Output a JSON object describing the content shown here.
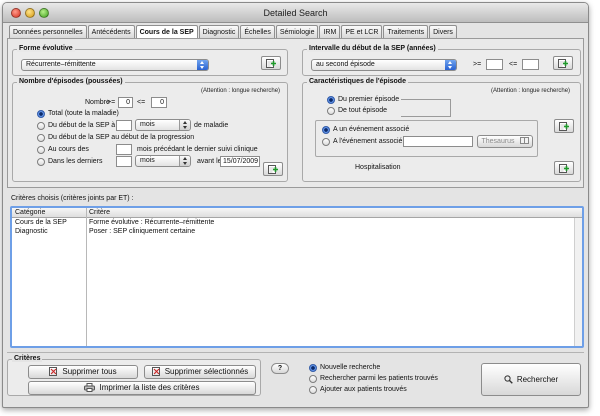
{
  "window": {
    "title": "Detailed Search"
  },
  "tabs": [
    "Données personnelles",
    "Antécédents",
    "Cours de la SEP",
    "Diagnostic",
    "Échelles",
    "Sémiologie",
    "IRM",
    "PE et LCR",
    "Traitements",
    "Divers"
  ],
  "active_tab": "Cours de la SEP",
  "forme_evolutive": {
    "title": "Forme évolutive",
    "value": "Récurrente–rémittente"
  },
  "intervalle": {
    "title": "Intervalle du début de la SEP (années)",
    "value": "au second épisode",
    "gte": ">=",
    "lte": "<=",
    "min": "",
    "max": ""
  },
  "episodes": {
    "title": "Nombre d'épisodes (poussées)",
    "warning": "(Attention : longue recherche)",
    "nombre_label": "Nombre",
    "gte": ">=",
    "lte": "<=",
    "min": "0",
    "max": "0",
    "options": [
      "Total (toute la maladie)",
      "Du début de la SEP à",
      "Du début de la SEP au début de la progression",
      "Au cours des",
      "Dans les derniers"
    ],
    "selected": "Total (toute la maladie)",
    "period_unit_1": "mois",
    "de_maladie": "de maladie",
    "mois_precedant": "mois précédant le dernier suivi clinique",
    "period_unit_2": "mois",
    "avant_le": "avant le",
    "date": "15/07/2009"
  },
  "caracteristiques": {
    "title": "Caractéristiques de l'épisode",
    "warning": "(Attention : longue recherche)",
    "episode_options": [
      "Du premier épisode",
      "De tout épisode"
    ],
    "event_options": [
      "A un événement associé",
      "A l'événement associé"
    ],
    "thesaurus_button": "Thesaurus",
    "hospitalisation": "Hospitalisation"
  },
  "criteres_choisis": {
    "label": "Critères choisis (critères joints par ET) :",
    "columns": [
      "Catégorie",
      "Critère"
    ],
    "rows": [
      {
        "categorie": "Cours de la SEP",
        "critere": "Forme évolutive : Récurrente–rémittente"
      },
      {
        "categorie": "Diagnostic",
        "critere": "Poser : SEP cliniquement certaine"
      }
    ]
  },
  "criteres": {
    "title": "Critères",
    "supprimer_tous": "Supprimer tous",
    "supprimer_selectionnes": "Supprimer sélectionnés",
    "imprimer": "Imprimer la liste des critères"
  },
  "help_button": "?",
  "search_mode": {
    "options": [
      "Nouvelle recherche",
      "Rechercher parmi les patients trouvés",
      "Ajouter aux patients trouvés"
    ],
    "selected": "Nouvelle recherche"
  },
  "search_button": "Rechercher"
}
